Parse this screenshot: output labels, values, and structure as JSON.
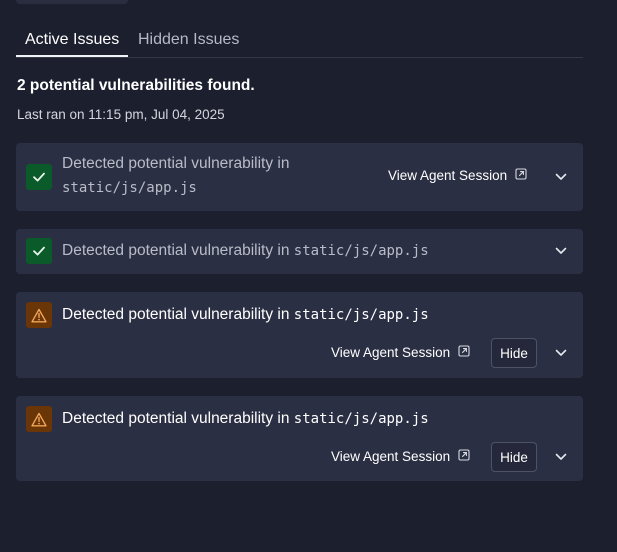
{
  "tabs": [
    {
      "label": "Active Issues",
      "active": true
    },
    {
      "label": "Hidden Issues",
      "active": false
    }
  ],
  "summary": {
    "title": "2 potential vulnerabilities found.",
    "last_ran": "Last ran on 11:15 pm, Jul 04, 2025"
  },
  "issues": [
    {
      "status": "check-icon",
      "text": "Detected potential vulnerability in",
      "file": "static/js/app.js",
      "agent_link": "View Agent Session"
    },
    {
      "status": "check-icon",
      "text": "Detected potential vulnerability in",
      "file": "static/js/app.js"
    },
    {
      "status": "warning-icon",
      "text": "Detected potential vulnerability in",
      "file": "static/js/app.js",
      "agent_link": "View Agent Session",
      "hide_label": "Hide"
    },
    {
      "status": "warning-icon",
      "text": "Detected potential vulnerability in",
      "file": "static/js/app.js",
      "agent_link": "View Agent Session",
      "hide_label": "Hide"
    }
  ],
  "colors": {
    "background": "#1c1f2e",
    "card": "#2b2f43",
    "resolved_icon_bg": "#0b5a2a",
    "warning_icon_bg": "#6a3507",
    "warning_icon_fg": "#f0a55a"
  }
}
